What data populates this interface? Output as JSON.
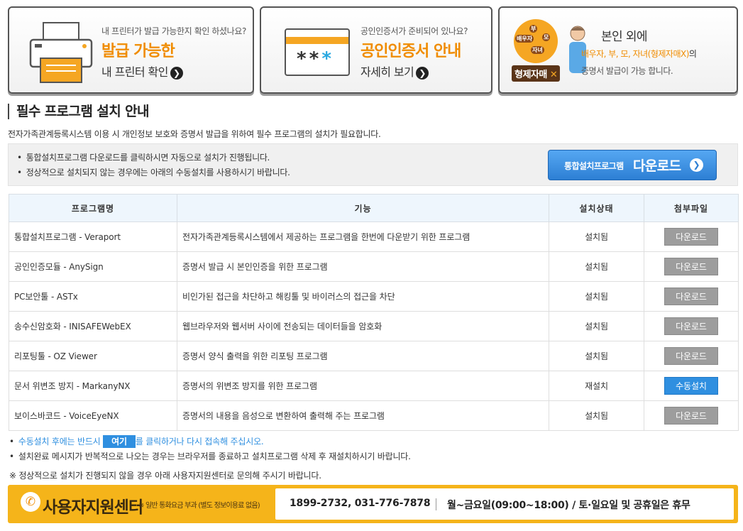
{
  "cards": {
    "printer": {
      "question": "내 프린터가 발급 가능한지 확인 하셨나요?",
      "headline": "발급 가능한",
      "action": "내 프린터 확인",
      "arrow": "❯"
    },
    "certificate": {
      "question": "공인인증서가 준비되어 있나요?",
      "headline": "공인인증서 안내",
      "action": "자세히 보기",
      "arrow": "❯",
      "stars_dark": "**",
      "stars_blue": "*"
    },
    "family": {
      "line1": "본인 외에",
      "line2_highlight": "배우자, 부, 모, 자녀(형제자매X)",
      "line2_suffix": "의",
      "line3": "증명서 발급이 가능 합니다.",
      "circle_labels": [
        "부",
        "모",
        "배우자",
        "자녀"
      ],
      "badge": "형제자매",
      "badge_x": "✕"
    }
  },
  "section": {
    "title": "필수 프로그램 설치 안내",
    "description": "전자가족관계등록시스템 이용 시 개인정보 보호와 증명서 발급을 위하여 필수 프로그램의 설치가 필요합니다."
  },
  "infobox": {
    "items": [
      "통합설치프로그램 다운로드를 클릭하시면 자동으로 설치가 진행됩니다.",
      "정상적으로 설치되지 않는 경우에는 아래의 수동설치를 사용하시기 바랍니다."
    ],
    "download_small": "통합설치프로그램",
    "download_big": "다운로드",
    "download_arrow": "❯"
  },
  "table": {
    "headers": [
      "프로그램명",
      "기능",
      "설치상태",
      "첨부파일"
    ],
    "rows": [
      {
        "name": "통합설치프로그램 - Veraport",
        "func": "전자가족관계등록시스템에서 제공하는 프로그램을 한번에 다운받기 위한 프로그램",
        "status": "설치됨",
        "button": "다운로드"
      },
      {
        "name": "공인인증모듈 - AnySign",
        "func": "증명서 발급 시 본인인증을 위한 프로그램",
        "status": "설치됨",
        "button": "다운로드"
      },
      {
        "name": "PC보안툴 - ASTx",
        "func": "비인가된 접근을 차단하고 해킹툴 및 바이러스의 접근을 차단",
        "status": "설치됨",
        "button": "다운로드"
      },
      {
        "name": "송수신암호화 - INISAFEWebEX",
        "func": "웹브라우저와 웹서버 사이에 전송되는 데이터들을 암호화",
        "status": "설치됨",
        "button": "다운로드"
      },
      {
        "name": "리포팅툴 - OZ Viewer",
        "func": "증명서 양식 출력을 위한 리포팅 프로그램",
        "status": "설치됨",
        "button": "다운로드"
      },
      {
        "name": "문서 위변조 방지 - MarkanyNX",
        "func": "증명서의 위변조 방지를 위한 프로그램",
        "status": "재설치",
        "button": "수동설치"
      },
      {
        "name": "보이스바코드 - VoiceEyeNX",
        "func": "증명서의 내용을 음성으로 변환하여 출력해 주는 프로그램",
        "status": "설치됨",
        "button": "다운로드"
      }
    ]
  },
  "notes": {
    "line1_before": "수동설치 후에는 반드시",
    "line1_button": "여기",
    "line1_after": "를 클릭하거나 다시 접속해 주십시오.",
    "line2": "설치완료 메시지가 반복적으로 나오는 경우는 브라우저를 종료하고 설치프로그램 삭제 후 재설치하시기 바랍니다.",
    "notice": "※ 정상적으로 설치가 진행되지 않을 경우 아래 사용자지원센터로 문의해 주시기 바랍니다."
  },
  "support": {
    "icon": "✆",
    "title": "사용자지원센터",
    "subtitle": "※ 일반 통화요금 부과 (별도 정보이용료 없음)",
    "numbers": "1899-2732, 031-776-7878",
    "hours": "월~금요일(09:00~18:00) / 토·일요일 및 공휴일은 휴무"
  },
  "colors": {
    "accent_orange": "#f08c00",
    "support_bar": "#f5b41a",
    "button_blue": "#2f8fe0",
    "button_gray": "#9d9d9d",
    "table_header_bg": "#eef6fd"
  }
}
